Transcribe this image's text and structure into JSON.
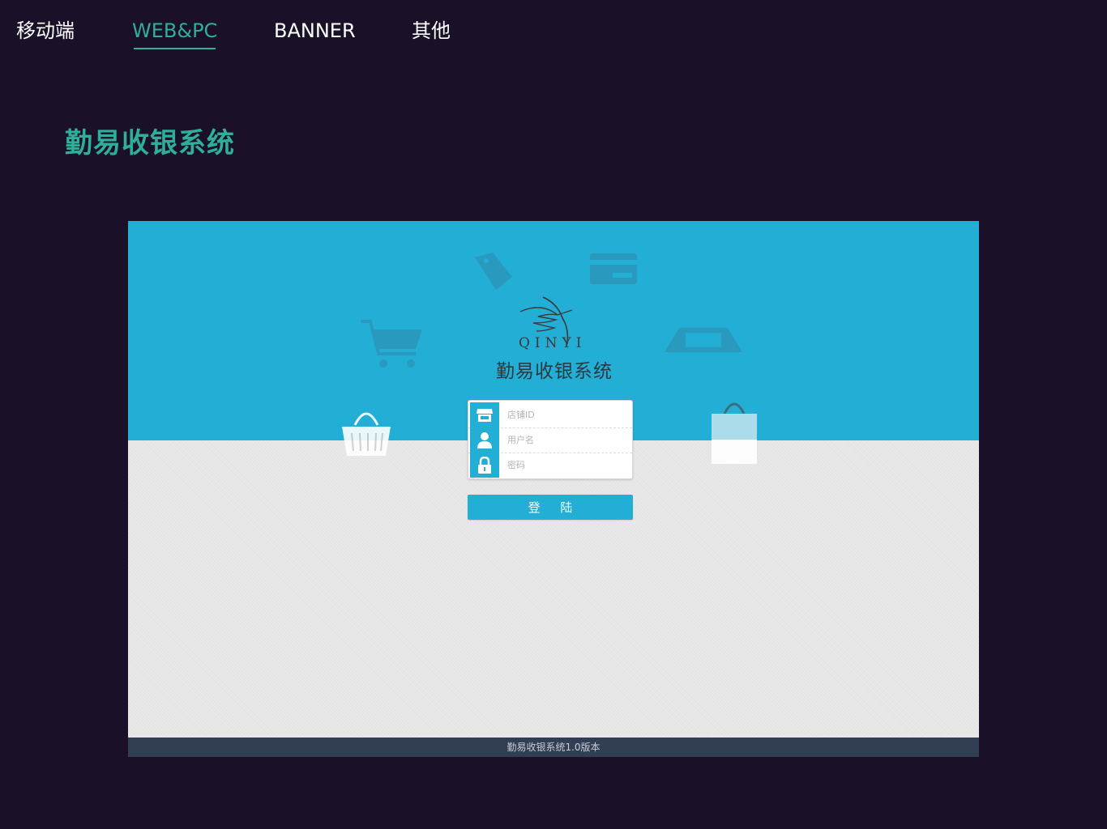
{
  "nav": {
    "tabs": [
      {
        "label": "移动端",
        "active": false
      },
      {
        "label": "WEB&PC",
        "active": true
      },
      {
        "label": "BANNER",
        "active": false
      },
      {
        "label": "其他",
        "active": false
      }
    ]
  },
  "section": {
    "title": "勤易收银系统"
  },
  "app": {
    "logo_text": "QINYI",
    "title": "勤易收银系统",
    "login": {
      "store_id_placeholder": "店铺ID",
      "username_placeholder": "用户名",
      "password_placeholder": "密码",
      "submit_label": "登 陆"
    },
    "footer": "勤易收银系统1.0版本"
  },
  "colors": {
    "page_bg": "#1a1028",
    "accent": "#2fae9c",
    "hero_blue": "#22aed5",
    "footer_bg": "#323e53"
  },
  "icons": [
    "store-icon",
    "user-icon",
    "lock-icon",
    "hummingbird-logo-icon",
    "shopping-cart-icon",
    "basket-icon",
    "shopping-bag-icon",
    "price-tag-icon",
    "credit-card-icon",
    "cash-register-icon"
  ]
}
